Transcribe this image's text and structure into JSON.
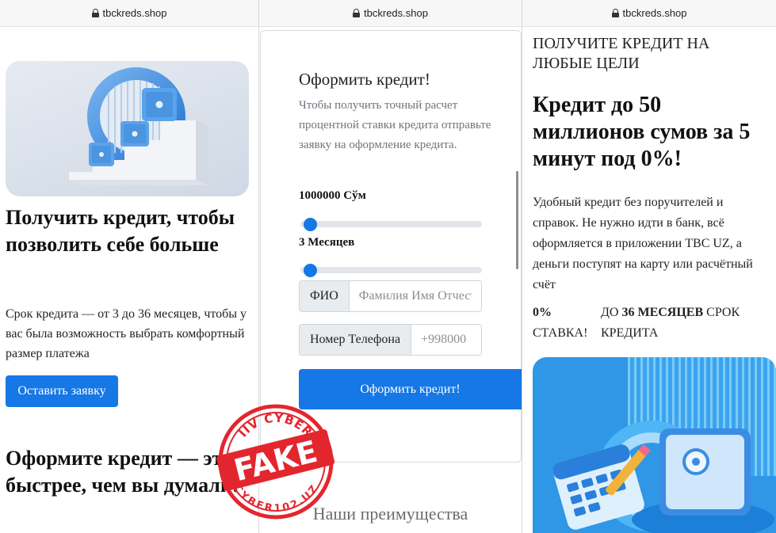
{
  "left_page": {
    "url": "tbckreds.shop",
    "headline": "Получить кредит, чтобы позволить себе больше",
    "description": "Срок кредита — от 3 до 36 месяцев, чтобы у вас была возможность выбрать комфортный размер платежа",
    "apply_button": "Оставить заявку",
    "subheadline": "Оформите кредит — это быстрее, чем вы думали!"
  },
  "middle_page": {
    "url": "tbckreds.shop",
    "form_title": "Оформить кредит!",
    "form_description": "Чтобы получить точный расчет процентной ставки кредита отправьте заявку на оформление кредита.",
    "amount_label": "1000000 Сўм",
    "amount_slider_fraction": 0.02,
    "term_label": "3 Месяцев",
    "term_slider_fraction": 0.02,
    "name_field": {
      "label": "ФИО",
      "placeholder": "Фамилия Имя Отчество"
    },
    "phone_field": {
      "label": "Номер Телефона",
      "placeholder": "+998000"
    },
    "submit_button": "Оформить кредит!",
    "advantages_heading": "Наши преимущества"
  },
  "right_page": {
    "url": "tbckreds.shop",
    "eyebrow": "ПОЛУЧИТЕ КРЕДИТ НА ЛЮБЫЕ ЦЕЛИ",
    "headline": "Кредит до 50 миллионов сумов за 5 минут под 0%!",
    "description": "Удобный кредит без поручителей и справок. Не нужно идти в банк, всё оформляется в приложении TBC UZ, а деньги поступят на карту или расчётный счёт",
    "feature_rate_value": "0%",
    "feature_rate_label": "СТАВКА!",
    "feature_term_prefix": "ДО",
    "feature_term_bold": "36 МЕСЯЦЕВ",
    "feature_term_suffix": "СРОК КРЕДИТА"
  },
  "stamp": {
    "top_text": "IIV CYBER",
    "main_text": "FAKE",
    "bottom_text": "CYBER102.UZ",
    "color": "#e3262e"
  },
  "colors": {
    "primary": "#1677e6",
    "text": "#111111",
    "muted": "#6c757d"
  }
}
